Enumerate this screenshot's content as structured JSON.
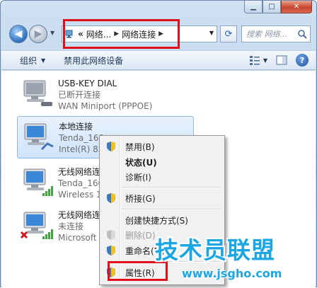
{
  "window": {
    "caption": {
      "minimize": "▁",
      "maximize": "□",
      "close": "✕"
    }
  },
  "nav": {
    "address": {
      "overflow": "«",
      "crumb1": "网络...",
      "crumb2": "网络连接"
    },
    "search_placeholder": "搜索 网络..."
  },
  "toolbar": {
    "organize": "组织",
    "disable_device": "禁用此网络设备"
  },
  "connections": [
    {
      "name": "USB-KEY DIAL",
      "status": "已断开连接",
      "device": "WAN Miniport (PPPOE)"
    },
    {
      "name": "本地连接",
      "status": "Tenda_160",
      "device": "Intel(R) 82"
    },
    {
      "name": "无线网络连",
      "status": "Tenda_160",
      "device": "Wireless 1"
    },
    {
      "name": "无线网络连",
      "status": "未连接",
      "device": "Microsoft"
    }
  ],
  "context_menu": {
    "items": [
      {
        "label": "禁用(B)"
      },
      {
        "label": "状态(U)"
      },
      {
        "label": "诊断(I)"
      },
      {
        "label": "桥接(G)"
      },
      {
        "label": "创建快捷方式(S)"
      },
      {
        "label": "删除(D)"
      },
      {
        "label": "重命名(M)"
      },
      {
        "label": "属性(R)"
      }
    ]
  },
  "watermark": {
    "title": "技术员联盟",
    "url": "www.jsgho.com"
  },
  "colors": {
    "highlight_box": "#e0101a",
    "watermark": "#1aa7e3"
  }
}
